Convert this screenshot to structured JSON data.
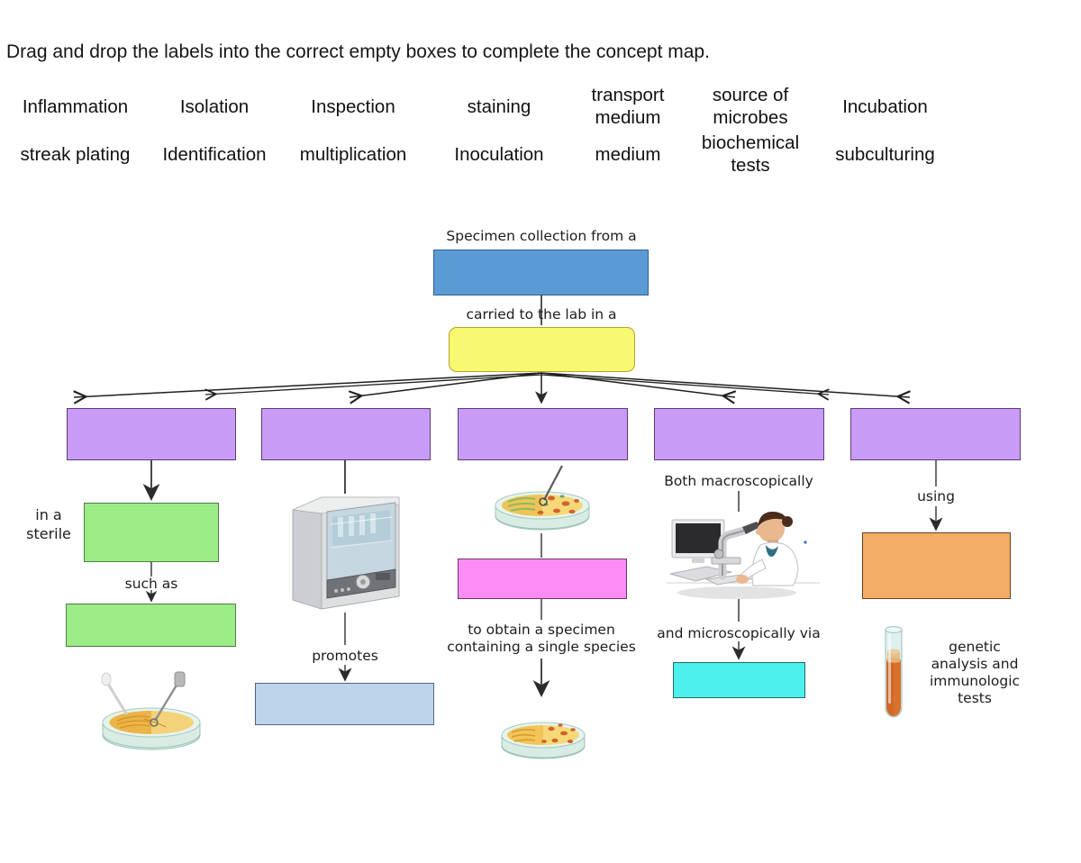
{
  "instruction": "Drag and drop the labels into the correct empty boxes to complete the concept map.",
  "label_bank": {
    "row1": [
      {
        "text": "Inflammation"
      },
      {
        "text": "Isolation"
      },
      {
        "text": "Inspection"
      },
      {
        "text": "staining"
      },
      {
        "text": "transport medium"
      },
      {
        "text": "source of microbes"
      },
      {
        "text": "Incubation"
      }
    ],
    "row2": [
      {
        "text": "streak plating"
      },
      {
        "text": "Identification"
      },
      {
        "text": "multiplication"
      },
      {
        "text": "Inoculation"
      },
      {
        "text": "medium"
      },
      {
        "text": "biochemical tests"
      },
      {
        "text": "subculturing"
      }
    ]
  },
  "concept_map": {
    "connectors": {
      "specimen_collection": "Specimen collection from a",
      "carried_to_lab": "carried to the lab in a",
      "in_a_sterile": "in a\nsterile",
      "such_as": "such as",
      "promotes": "promotes",
      "to_obtain": "to obtain a specimen\ncontaining a single species",
      "both_macroscopically": "Both macroscopically",
      "and_microscopically": "and microscopically via",
      "using": "using",
      "genetic_tests": "genetic\nanalysis and\nimmunologic\ntests"
    },
    "boxes": {
      "blue_top": "",
      "yellow_transport": "",
      "purple_1": "",
      "purple_2": "",
      "purple_3": "",
      "purple_4": "",
      "purple_5": "",
      "green_1": "",
      "green_2": "",
      "lightblue_1": "",
      "pink_1": "",
      "cyan_1": "",
      "orange_1": ""
    },
    "images": {
      "streak_plate": "petri-dish-streak-plate-image",
      "incubator": "laboratory-incubator-image",
      "inoculated_plate": "petri-dish-inoculated-image",
      "colony_plate": "petri-dish-colonies-image",
      "microscope_scientist": "scientist-at-microscope-image",
      "test_tube": "test-tube-image"
    }
  },
  "colors": {
    "blue": "#5B9BD5",
    "yellow": "#F9F871",
    "purple": "#C89CF6",
    "green": "#9BEB86",
    "light_blue": "#BCD5EA",
    "pink": "#FB8CF6",
    "cyan": "#4EF0EE",
    "orange": "#F3AC66"
  }
}
